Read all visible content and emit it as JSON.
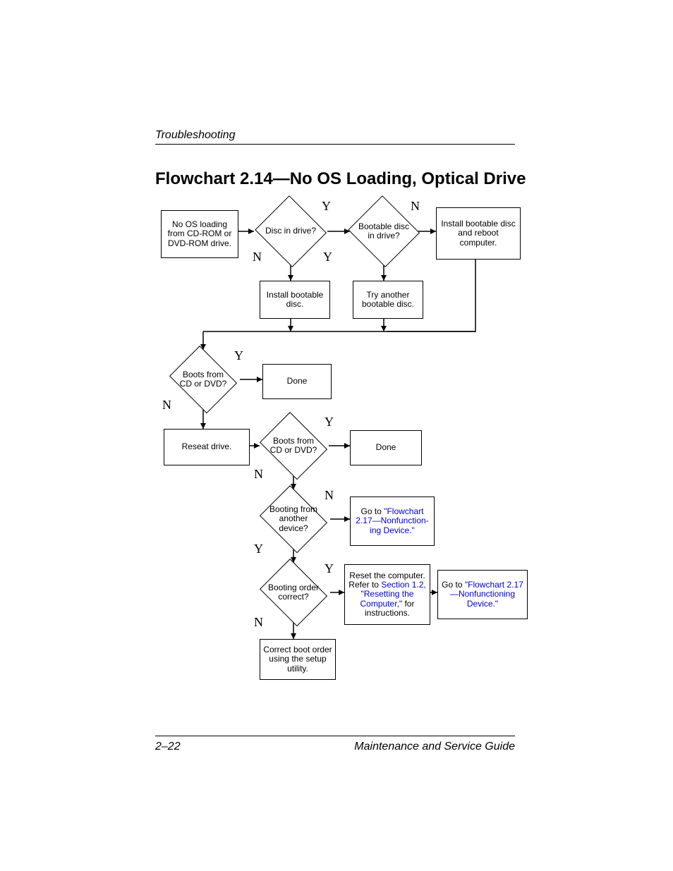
{
  "header": "Troubleshooting",
  "title": "Flowchart 2.14—No OS Loading, Optical Drive",
  "footer": {
    "page": "2–22",
    "guide": "Maintenance and Service Guide"
  },
  "labels": {
    "Y": "Y",
    "N": "N"
  },
  "nodes": {
    "start": "No OS loading from CD-ROM or DVD-ROM drive.",
    "disc_in_drive": "Disc in drive?",
    "bootable_in_drive": "Bootable disc in drive?",
    "install_reboot": "Install bootable disc and reboot computer.",
    "install_disc": "Install bootable disc.",
    "try_another": "Try another bootable disc.",
    "boots1": "Boots from CD or DVD?",
    "done1": "Done",
    "reseat": "Reseat drive.",
    "boots2": "Boots from CD or DVD?",
    "done2": "Done",
    "another_device": "Booting from another device?",
    "goto17a_pre": "Go to ",
    "goto17a_link": "\"Flowchart 2.17—Nonfunction- ing Device.\"",
    "order_correct": "Booting order correct?",
    "reset_pre": "Reset the computer. Refer to ",
    "reset_link": "Section 1.2, \"Resetting the Computer,\"",
    "reset_post": " for instructions.",
    "goto17b_pre": "Go to ",
    "goto17b_link": "\"Flowchart 2.17—Nonfunctioning Device.\"",
    "correct_boot": "Correct boot order using the setup utility."
  }
}
